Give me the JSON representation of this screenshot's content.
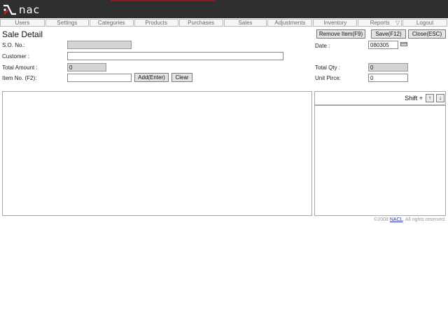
{
  "brand": {
    "logo_text": "nac"
  },
  "nav": [
    {
      "label": "Users"
    },
    {
      "label": "Settings"
    },
    {
      "label": "Categories"
    },
    {
      "label": "Products"
    },
    {
      "label": "Purchases"
    },
    {
      "label": "Sales"
    },
    {
      "label": "Adjustments"
    },
    {
      "label": "Inventory"
    },
    {
      "label": "Reports"
    },
    {
      "label": "Logout"
    }
  ],
  "page": {
    "title": "Sale Detail"
  },
  "toolbar": {
    "remove_label": "Remove Item(F9)",
    "save_label": "Save(F12)",
    "close_label": "Close(ESC)"
  },
  "form": {
    "so_no": {
      "label": "S.O. No.:",
      "value": ""
    },
    "customer": {
      "label": "Customer :",
      "value": ""
    },
    "total_amount": {
      "label": "Total Amount :",
      "value": "0"
    },
    "item_no": {
      "label": "Item No. (F2):",
      "value": ""
    },
    "add_label": "Add(Enter)",
    "clear_label": "Clear",
    "date": {
      "label": "Date :",
      "value": "080305"
    },
    "total_qty": {
      "label": "Total Qty :",
      "value": "0"
    },
    "unit_price": {
      "label": "Unit Pirce:",
      "value": "0"
    }
  },
  "shift": {
    "label": "Shift +",
    "up": "↑",
    "down": "↓"
  },
  "footer": {
    "prefix": "©2008 ",
    "link": "NACL",
    "suffix": ". All rights reserved."
  },
  "colors": {
    "topbar": "#2f2f2f",
    "accent": "#cc2222",
    "readonly_field": "#d4d4d4"
  }
}
